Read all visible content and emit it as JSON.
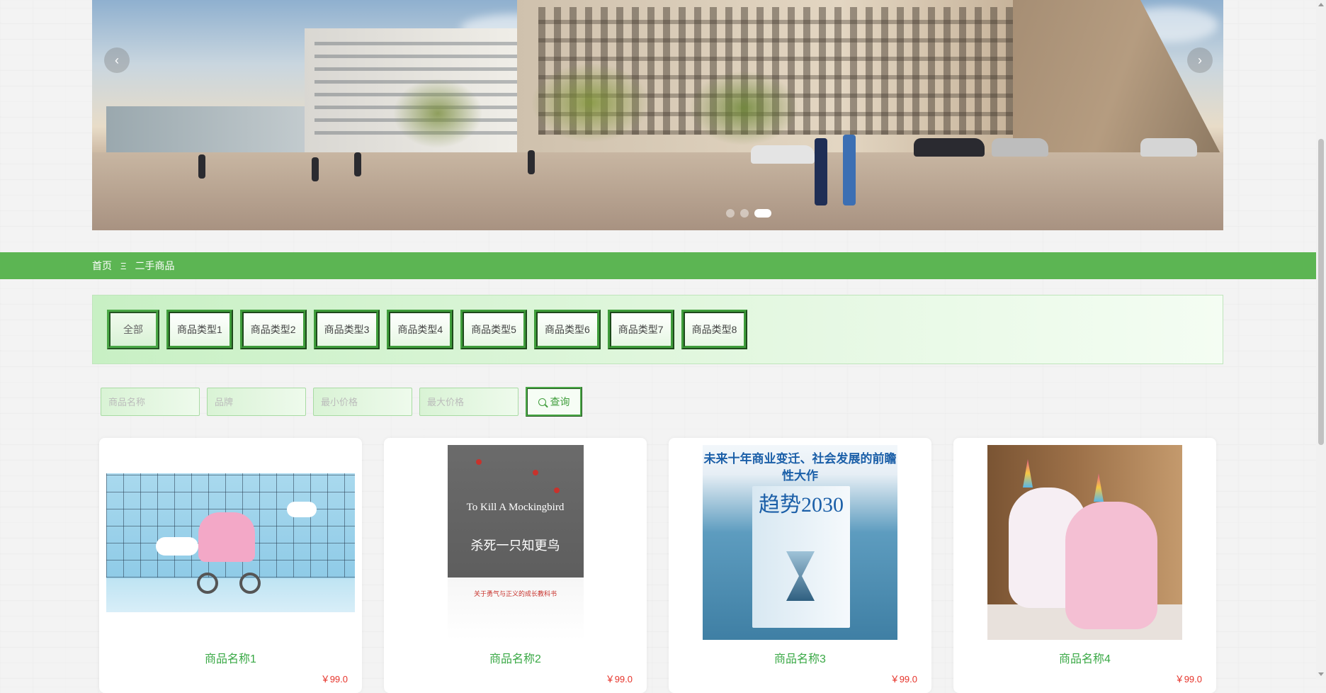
{
  "carousel": {
    "prev_icon": "‹",
    "next_icon": "›",
    "slides": [
      "slide-1",
      "slide-2",
      "slide-3"
    ],
    "active_index": 2
  },
  "breadcrumb": {
    "home": "首页",
    "separator": "Ξ",
    "current": "二手商品"
  },
  "categories": [
    {
      "label": "全部",
      "active": true
    },
    {
      "label": "商品类型1",
      "active": false
    },
    {
      "label": "商品类型2",
      "active": false
    },
    {
      "label": "商品类型3",
      "active": false
    },
    {
      "label": "商品类型4",
      "active": false
    },
    {
      "label": "商品类型5",
      "active": false
    },
    {
      "label": "商品类型6",
      "active": false
    },
    {
      "label": "商品类型7",
      "active": false
    },
    {
      "label": "商品类型8",
      "active": false
    }
  ],
  "search": {
    "name_placeholder": "商品名称",
    "brand_placeholder": "品牌",
    "min_price_placeholder": "最小价格",
    "max_price_placeholder": "最大价格",
    "button_label": "查询",
    "button_icon": "search-icon"
  },
  "products": [
    {
      "name": "商品名称1",
      "price": "￥99.0",
      "image": "baby-stroller-scene"
    },
    {
      "name": "商品名称2",
      "price": "￥99.0",
      "image": "book-cover",
      "cover_title": "To Kill A Mockingbird",
      "cover_cn": "杀死一只知更鸟",
      "cover_note": "关于勇气与正义的成长教科书"
    },
    {
      "name": "商品名称3",
      "price": "￥99.0",
      "image": "book-cover",
      "cover_headline": "未来十年商业变迁、社会发展的前瞻性大作",
      "cover_title": "趋势2030"
    },
    {
      "name": "商品名称4",
      "price": "￥99.0",
      "image": "unicorn-plush"
    }
  ],
  "colors": {
    "accent_green": "#5cb553",
    "product_name": "#39a845",
    "price_red": "#e6332a"
  }
}
